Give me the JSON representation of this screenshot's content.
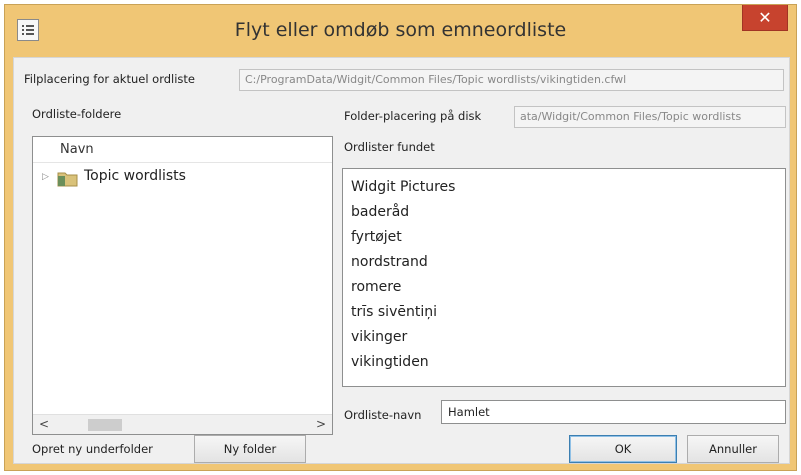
{
  "window": {
    "title": "Flyt eller omdøb som emneordliste",
    "close_glyph": "✕",
    "icon": "list-app-icon"
  },
  "current_path": {
    "label": "Filplacering for aktuel ordliste",
    "value": "C:/ProgramData/Widgit/Common Files/Topic wordlists/vikingtiden.cfwl"
  },
  "folders": {
    "label": "Ordliste-foldere",
    "column_header": "Navn",
    "items": [
      {
        "label": "Topic wordlists",
        "icon": "folder-icon",
        "expander": "▷"
      }
    ],
    "scroll_left": "<",
    "scroll_right": ">"
  },
  "disk_location": {
    "label": "Folder-placering på disk",
    "value": "ata/Widgit/Common Files/Topic wordlists"
  },
  "found": {
    "label": "Ordlister fundet",
    "items": [
      "Widgit Pictures",
      "baderåd",
      "fyrtøjet",
      "nordstrand",
      "romere",
      "trīs sivēntiņi",
      "vikinger",
      "vikingtiden"
    ]
  },
  "name_field": {
    "label": "Ordliste-navn",
    "value": "Hamlet"
  },
  "new_subfolder": {
    "label": "Opret ny underfolder",
    "button": "Ny folder"
  },
  "buttons": {
    "ok": "OK",
    "cancel": "Annuller"
  },
  "colors": {
    "title_bar": "#f0c675",
    "close_button": "#c7432e",
    "dialog_bg": "#f0f0f0"
  }
}
